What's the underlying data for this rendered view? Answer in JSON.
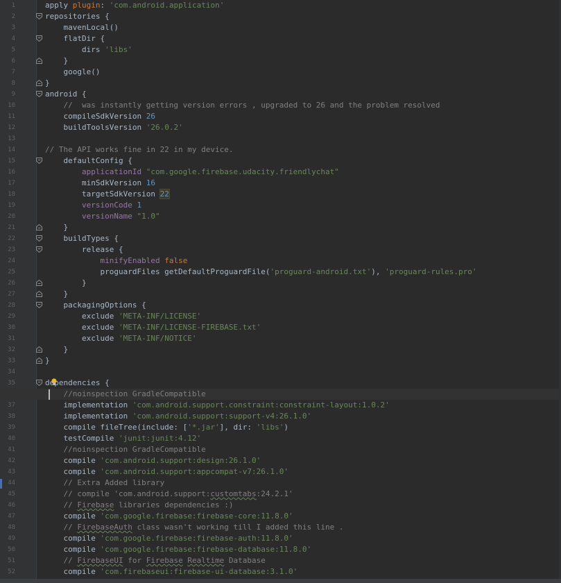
{
  "editor": {
    "colors": {
      "background": "#2b2b2b",
      "gutter": "#313335",
      "plain": "#a9b7c6",
      "keyword": "#cc7832",
      "string": "#6a8759",
      "number": "#6897bb",
      "comment": "#808080",
      "property": "#9876aa"
    },
    "icons": [
      "fold-open-icon",
      "fold-close-icon",
      "lightbulb-icon"
    ],
    "lines": [
      {
        "n": "1",
        "fold": "",
        "tokens": [
          {
            "c": "plain",
            "t": "apply "
          },
          {
            "c": "keyword",
            "t": "plugin"
          },
          {
            "c": "plain",
            "t": ": "
          },
          {
            "c": "string",
            "t": "'com.android.application'"
          }
        ]
      },
      {
        "n": "2",
        "fold": "open",
        "tokens": [
          {
            "c": "plain",
            "t": "repositories {"
          }
        ]
      },
      {
        "n": "3",
        "fold": "",
        "tokens": [
          {
            "c": "plain",
            "t": "    mavenLocal()"
          }
        ]
      },
      {
        "n": "4",
        "fold": "open",
        "tokens": [
          {
            "c": "plain",
            "t": "    flatDir {"
          }
        ]
      },
      {
        "n": "5",
        "fold": "",
        "tokens": [
          {
            "c": "plain",
            "t": "        dirs "
          },
          {
            "c": "string",
            "t": "'libs'"
          }
        ]
      },
      {
        "n": "6",
        "fold": "close",
        "tokens": [
          {
            "c": "plain",
            "t": "    }"
          }
        ]
      },
      {
        "n": "7",
        "fold": "",
        "tokens": [
          {
            "c": "plain",
            "t": "    google()"
          }
        ]
      },
      {
        "n": "8",
        "fold": "close",
        "tokens": [
          {
            "c": "plain",
            "t": "}"
          }
        ]
      },
      {
        "n": "9",
        "fold": "open",
        "tokens": [
          {
            "c": "plain",
            "t": "android {"
          }
        ]
      },
      {
        "n": "10",
        "fold": "",
        "tokens": [
          {
            "c": "comment",
            "t": "    //  was instantly getting version errors , upgraded to 26 and the problem resolved"
          }
        ]
      },
      {
        "n": "11",
        "fold": "",
        "tokens": [
          {
            "c": "plain",
            "t": "    compileSdkVersion "
          },
          {
            "c": "number",
            "t": "26"
          }
        ]
      },
      {
        "n": "12",
        "fold": "",
        "tokens": [
          {
            "c": "plain",
            "t": "    buildToolsVersion "
          },
          {
            "c": "string",
            "t": "'26.0.2'"
          }
        ]
      },
      {
        "n": "13",
        "fold": "",
        "tokens": []
      },
      {
        "n": "14",
        "fold": "",
        "tokens": [
          {
            "c": "comment",
            "t": "// The API works fine in 22 in my device."
          }
        ]
      },
      {
        "n": "15",
        "fold": "open",
        "tokens": [
          {
            "c": "plain",
            "t": "    defaultConfig {"
          }
        ]
      },
      {
        "n": "16",
        "fold": "",
        "tokens": [
          {
            "c": "plain",
            "t": "        "
          },
          {
            "c": "property",
            "t": "applicationId "
          },
          {
            "c": "string",
            "t": "\"com.google.firebase.udacity.friendlychat\""
          }
        ]
      },
      {
        "n": "17",
        "fold": "",
        "tokens": [
          {
            "c": "plain",
            "t": "        minSdkVersion "
          },
          {
            "c": "number",
            "t": "16"
          }
        ]
      },
      {
        "n": "18",
        "fold": "",
        "tokens": [
          {
            "c": "plain",
            "t": "        targetSdkVersion "
          },
          {
            "c": "number-hl",
            "t": "22"
          }
        ]
      },
      {
        "n": "19",
        "fold": "",
        "tokens": [
          {
            "c": "plain",
            "t": "        "
          },
          {
            "c": "property",
            "t": "versionCode "
          },
          {
            "c": "number",
            "t": "1"
          }
        ]
      },
      {
        "n": "20",
        "fold": "",
        "tokens": [
          {
            "c": "plain",
            "t": "        "
          },
          {
            "c": "property",
            "t": "versionName "
          },
          {
            "c": "string",
            "t": "\"1.0\""
          }
        ]
      },
      {
        "n": "21",
        "fold": "close",
        "tokens": [
          {
            "c": "plain",
            "t": "    }"
          }
        ]
      },
      {
        "n": "22",
        "fold": "open",
        "tokens": [
          {
            "c": "plain",
            "t": "    buildTypes {"
          }
        ]
      },
      {
        "n": "23",
        "fold": "open",
        "tokens": [
          {
            "c": "plain",
            "t": "        release {"
          }
        ]
      },
      {
        "n": "24",
        "fold": "",
        "tokens": [
          {
            "c": "plain",
            "t": "            "
          },
          {
            "c": "property",
            "t": "minifyEnabled "
          },
          {
            "c": "keyword",
            "t": "false"
          }
        ]
      },
      {
        "n": "25",
        "fold": "",
        "tokens": [
          {
            "c": "plain",
            "t": "            proguardFiles getDefaultProguardFile("
          },
          {
            "c": "string",
            "t": "'proguard-android.txt'"
          },
          {
            "c": "plain",
            "t": "), "
          },
          {
            "c": "string",
            "t": "'proguard-rules.pro'"
          }
        ]
      },
      {
        "n": "26",
        "fold": "close",
        "tokens": [
          {
            "c": "plain",
            "t": "        }"
          }
        ]
      },
      {
        "n": "27",
        "fold": "close",
        "tokens": [
          {
            "c": "plain",
            "t": "    }"
          }
        ]
      },
      {
        "n": "28",
        "fold": "open",
        "tokens": [
          {
            "c": "plain",
            "t": "    packagingOptions {"
          }
        ]
      },
      {
        "n": "29",
        "fold": "",
        "tokens": [
          {
            "c": "plain",
            "t": "        exclude "
          },
          {
            "c": "string",
            "t": "'META-INF/LICENSE'"
          }
        ]
      },
      {
        "n": "30",
        "fold": "",
        "tokens": [
          {
            "c": "plain",
            "t": "        exclude "
          },
          {
            "c": "string",
            "t": "'META-INF/LICENSE-FIREBASE.txt'"
          }
        ]
      },
      {
        "n": "31",
        "fold": "",
        "tokens": [
          {
            "c": "plain",
            "t": "        exclude "
          },
          {
            "c": "string",
            "t": "'META-INF/NOTICE'"
          }
        ]
      },
      {
        "n": "32",
        "fold": "close",
        "tokens": [
          {
            "c": "plain",
            "t": "    }"
          }
        ]
      },
      {
        "n": "33",
        "fold": "close",
        "tokens": [
          {
            "c": "plain",
            "t": "}"
          }
        ]
      },
      {
        "n": "34",
        "fold": "",
        "tokens": []
      },
      {
        "n": "35",
        "fold": "open",
        "tokens": [
          {
            "c": "plain",
            "t": "dependencies {"
          }
        ]
      },
      {
        "n": "36",
        "fold": "",
        "caret": true,
        "tokens": [
          {
            "c": "comment",
            "t": "    //noinspection GradleCompatible"
          }
        ]
      },
      {
        "n": "37",
        "fold": "",
        "tokens": [
          {
            "c": "plain",
            "t": "    implementation "
          },
          {
            "c": "string",
            "t": "'com.android.support.constraint:constraint-layout:1.0.2'"
          }
        ]
      },
      {
        "n": "38",
        "fold": "",
        "tokens": [
          {
            "c": "plain",
            "t": "    implementation "
          },
          {
            "c": "string",
            "t": "'com.android.support:support-v4:26.1.0'"
          }
        ]
      },
      {
        "n": "39",
        "fold": "",
        "tokens": [
          {
            "c": "plain",
            "t": "    compile fileTree(include: ["
          },
          {
            "c": "string",
            "t": "'*.jar'"
          },
          {
            "c": "plain",
            "t": "], dir: "
          },
          {
            "c": "string",
            "t": "'libs'"
          },
          {
            "c": "plain",
            "t": ")"
          }
        ]
      },
      {
        "n": "40",
        "fold": "",
        "tokens": [
          {
            "c": "plain",
            "t": "    testCompile "
          },
          {
            "c": "string",
            "t": "'junit:junit:4.12'"
          }
        ]
      },
      {
        "n": "41",
        "fold": "",
        "tokens": [
          {
            "c": "comment",
            "t": "    //noinspection GradleCompatible"
          }
        ]
      },
      {
        "n": "42",
        "fold": "",
        "tokens": [
          {
            "c": "plain",
            "t": "    compile "
          },
          {
            "c": "string",
            "t": "'com.android.support:design:26.1.0'"
          }
        ]
      },
      {
        "n": "43",
        "fold": "",
        "tokens": [
          {
            "c": "plain",
            "t": "    compile "
          },
          {
            "c": "string",
            "t": "'com.android.support:appcompat-v7:26.1.0'"
          }
        ]
      },
      {
        "n": "44",
        "fold": "",
        "tokens": [
          {
            "c": "comment",
            "t": "    // Extra Added library"
          }
        ]
      },
      {
        "n": "45",
        "fold": "",
        "tokens": [
          {
            "c": "comment",
            "t": "    // compile 'com.android.support:"
          },
          {
            "c": "comment squiggle",
            "t": "customtabs"
          },
          {
            "c": "comment",
            "t": ":24.2.1'"
          }
        ]
      },
      {
        "n": "46",
        "fold": "",
        "tokens": [
          {
            "c": "comment",
            "t": "    // "
          },
          {
            "c": "comment squiggle",
            "t": "Firebase"
          },
          {
            "c": "comment",
            "t": " libraries dependencies :)"
          }
        ]
      },
      {
        "n": "47",
        "fold": "",
        "tokens": [
          {
            "c": "plain",
            "t": "    compile "
          },
          {
            "c": "string",
            "t": "'com.google.firebase:firebase-core:11.8.0'"
          }
        ]
      },
      {
        "n": "48",
        "fold": "",
        "tokens": [
          {
            "c": "comment",
            "t": "    // "
          },
          {
            "c": "comment squiggle",
            "t": "FirebaseAuth"
          },
          {
            "c": "comment",
            "t": " class wasn't working till I added this line ."
          }
        ]
      },
      {
        "n": "49",
        "fold": "",
        "tokens": [
          {
            "c": "plain",
            "t": "    compile "
          },
          {
            "c": "string",
            "t": "'com.google.firebase:firebase-auth:11.8.0'"
          }
        ]
      },
      {
        "n": "50",
        "fold": "",
        "tokens": [
          {
            "c": "plain",
            "t": "    compile "
          },
          {
            "c": "string",
            "t": "'com.google.firebase:firebase-database:11.8.0'"
          }
        ]
      },
      {
        "n": "51",
        "fold": "",
        "tokens": [
          {
            "c": "comment",
            "t": "    // "
          },
          {
            "c": "comment squiggle",
            "t": "FirebaseUI"
          },
          {
            "c": "comment",
            "t": " for "
          },
          {
            "c": "comment squiggle",
            "t": "Firebase"
          },
          {
            "c": "comment",
            "t": " "
          },
          {
            "c": "comment squiggle",
            "t": "Realtime"
          },
          {
            "c": "comment",
            "t": " Database"
          }
        ]
      },
      {
        "n": "52",
        "fold": "",
        "tokens": [
          {
            "c": "plain",
            "t": "    compile "
          },
          {
            "c": "string",
            "t": "'com.firebaseui:firebase-ui-database:3.1.0'"
          }
        ]
      }
    ]
  }
}
